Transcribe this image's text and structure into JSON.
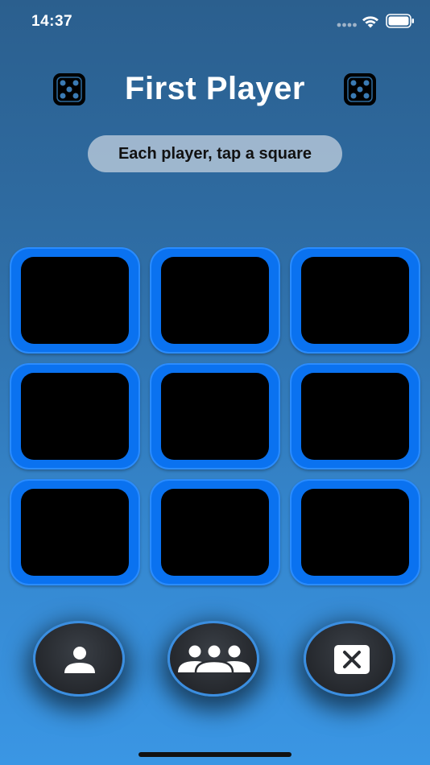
{
  "status_bar": {
    "time": "14:37"
  },
  "header": {
    "title": "First Player",
    "hint": "Each player, tap a square"
  },
  "grid": {
    "rows": 3,
    "columns": 3
  },
  "controls": {
    "single_player_icon": "person-icon",
    "multi_player_icon": "people-group-icon",
    "clear_icon": "clear-x-icon"
  },
  "colors": {
    "square_border": "#0a72f0",
    "square_fill": "#000000",
    "button_ring": "#3b8ee0"
  }
}
